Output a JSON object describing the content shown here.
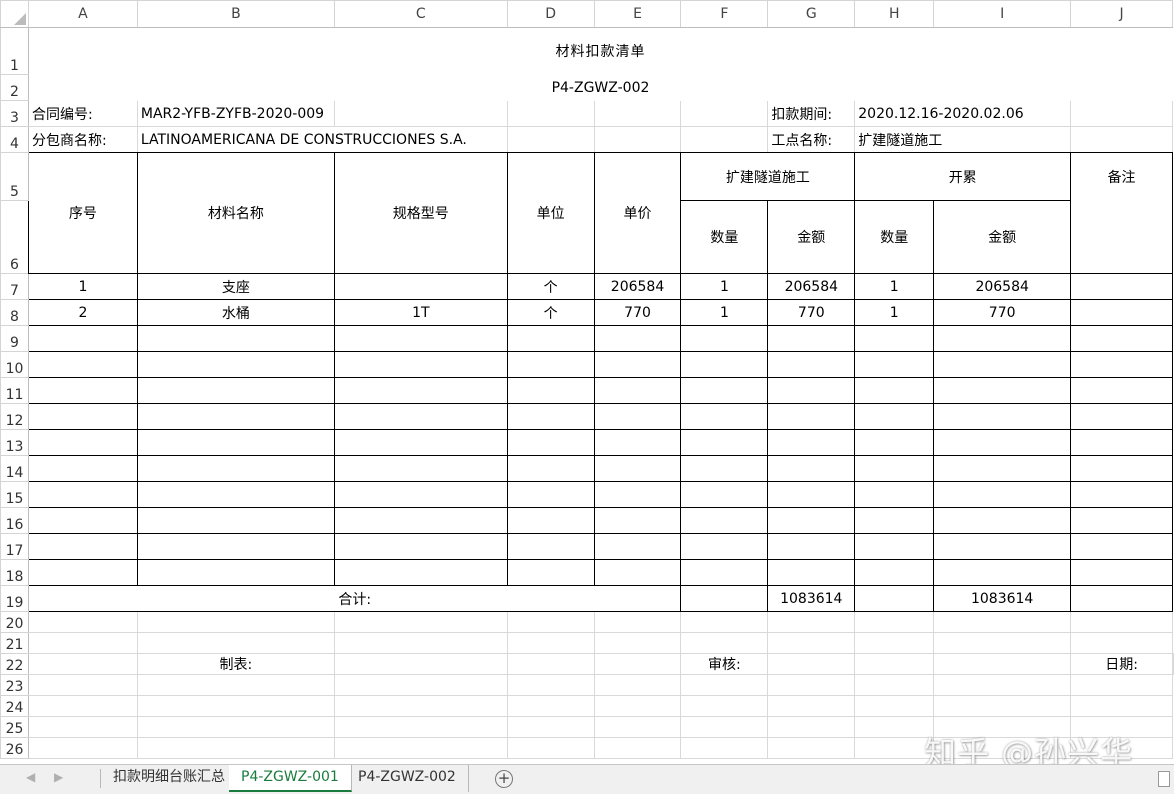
{
  "columns": [
    "A",
    "B",
    "C",
    "D",
    "E",
    "F",
    "G",
    "H",
    "I",
    "J"
  ],
  "rows": [
    "1",
    "2",
    "3",
    "4",
    "5",
    "6",
    "7",
    "8",
    "9",
    "10",
    "11",
    "12",
    "13",
    "14",
    "15",
    "16",
    "17",
    "18",
    "19",
    "20",
    "21",
    "22",
    "23",
    "24",
    "25",
    "26"
  ],
  "sheet": {
    "title": "材料扣款清单",
    "code": "P4-ZGWZ-002",
    "contract_label": "合同编号:",
    "contract_value": "MAR2-YFB-ZYFB-2020-009",
    "period_label": "扣款期间:",
    "period_value": "2020.12.16-2020.02.06",
    "sub_label": "分包商名称:",
    "sub_value": "LATINOAMERICANA DE CONSTRUCCIONES S.A.",
    "site_label": "工点名称:",
    "site_value": "扩建隧道施工",
    "headers": {
      "no": "序号",
      "name": "材料名称",
      "spec": "规格型号",
      "unit": "单位",
      "price": "单价",
      "group1": "扩建隧道施工",
      "group2": "开累",
      "remark": "备注",
      "qty1": "数量",
      "amt1": "金额",
      "qty2": "数量",
      "amt2": "金额"
    },
    "items": [
      {
        "no": "1",
        "name": "支座",
        "spec": "",
        "unit": "个",
        "price": "206584",
        "qty1": "1",
        "amt1": "206584",
        "qty2": "1",
        "amt2": "206584",
        "remark": ""
      },
      {
        "no": "2",
        "name": "水桶",
        "spec": "1T",
        "unit": "个",
        "price": "770",
        "qty1": "1",
        "amt1": "770",
        "qty2": "1",
        "amt2": "770",
        "remark": ""
      }
    ],
    "total_label": "合计:",
    "total_amt1": "1083614",
    "total_amt2": "1083614",
    "maker_label": "制表:",
    "reviewer_label": "审核:",
    "date_label": "日期:"
  },
  "tabs": [
    {
      "label": "扣款明细台账汇总",
      "active": false
    },
    {
      "label": "P4-ZGWZ-001",
      "active": true
    },
    {
      "label": "P4-ZGWZ-002",
      "active": false
    }
  ],
  "nav": {
    "prev": "◀",
    "next": "▶",
    "add": "+"
  },
  "watermark": "知乎 @孙兴华",
  "colors": {
    "active_tab": "#1a7c3c",
    "gridline": "#d9d9d9",
    "border": "#000000"
  }
}
